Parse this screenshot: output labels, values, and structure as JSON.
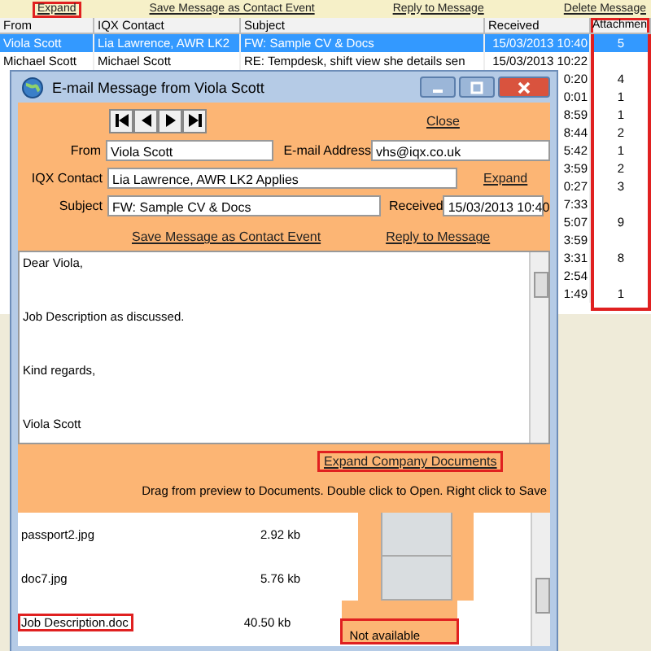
{
  "toolbar": {
    "links": [
      {
        "label": "Expand",
        "highlighted": true
      },
      {
        "label": "Save Message as Contact Event",
        "highlighted": false
      },
      {
        "label": "Reply to Message",
        "highlighted": false
      },
      {
        "label": "Delete Message",
        "highlighted": false
      }
    ]
  },
  "table": {
    "columns": [
      {
        "label": "From",
        "highlighted": false
      },
      {
        "label": "IQX Contact",
        "highlighted": false
      },
      {
        "label": "Subject",
        "highlighted": false
      },
      {
        "label": "Received",
        "highlighted": false
      },
      {
        "label": "Attachmen",
        "highlighted": true
      }
    ],
    "rows": [
      {
        "from": "Viola Scott",
        "contact": "Lia Lawrence, AWR LK2",
        "subject": "FW: Sample CV & Docs",
        "received": "15/03/2013 10:40",
        "attachments": "5",
        "selected": true
      },
      {
        "from": "Michael Scott",
        "contact": "Michael Scott",
        "subject": "RE: Tempdesk, shift view she details sen",
        "received": "15/03/2013 10:22",
        "attachments": "",
        "selected": false
      },
      {
        "received": "0:20",
        "attachments": "4",
        "selected": false
      },
      {
        "received": "0:01",
        "attachments": "1",
        "selected": false
      },
      {
        "received": "8:59",
        "attachments": "1",
        "selected": false
      },
      {
        "received": "8:44",
        "attachments": "2",
        "selected": false
      },
      {
        "received": "5:42",
        "attachments": "1",
        "selected": false
      },
      {
        "received": "3:59",
        "attachments": "2",
        "selected": false
      },
      {
        "received": "0:27",
        "attachments": "3",
        "selected": false
      },
      {
        "received": "7:33",
        "attachments": "",
        "selected": false
      },
      {
        "received": "5:07",
        "attachments": "9",
        "selected": false
      },
      {
        "received": "3:59",
        "attachments": "",
        "selected": false
      },
      {
        "received": "3:31",
        "attachments": "8",
        "selected": false
      },
      {
        "received": "2:54",
        "attachments": "",
        "selected": false
      },
      {
        "received": "1:49",
        "attachments": "1",
        "selected": false
      }
    ]
  },
  "dialog": {
    "title": "E-mail Message from Viola Scott",
    "close_link": "Close",
    "fields": {
      "from_label": "From",
      "from": "Viola Scott",
      "email_label": "E-mail Address",
      "email": "vhs@iqx.co.uk",
      "contact_label": "IQX Contact",
      "contact": "Lia Lawrence, AWR LK2 Applies",
      "expand_link": "Expand",
      "subject_label": "Subject",
      "subject": "FW: Sample CV & Docs",
      "received_label": "Received",
      "received": "15/03/2013 10:40"
    },
    "actions": [
      "Save Message as Contact Event",
      "Reply to Message"
    ],
    "body": [
      "Dear Viola,",
      "Job Description as discussed.",
      "Kind regards,",
      "Viola Scott"
    ],
    "expand_documents": {
      "label": "Expand Company Documents",
      "highlighted": true
    },
    "hint": "Drag from preview to Documents.  Double click to Open.  Right click to Save",
    "attachments": [
      {
        "name": "passport2.jpg",
        "size": "2.92 kb",
        "kind": "image",
        "highlighted": false
      },
      {
        "name": "doc7.jpg",
        "size": "5.76 kb",
        "kind": "image",
        "highlighted": false
      },
      {
        "name": "Job Description.doc",
        "size": "40.50 kb",
        "kind": "unavailable",
        "preview": "Not available",
        "highlighted": true
      }
    ]
  }
}
